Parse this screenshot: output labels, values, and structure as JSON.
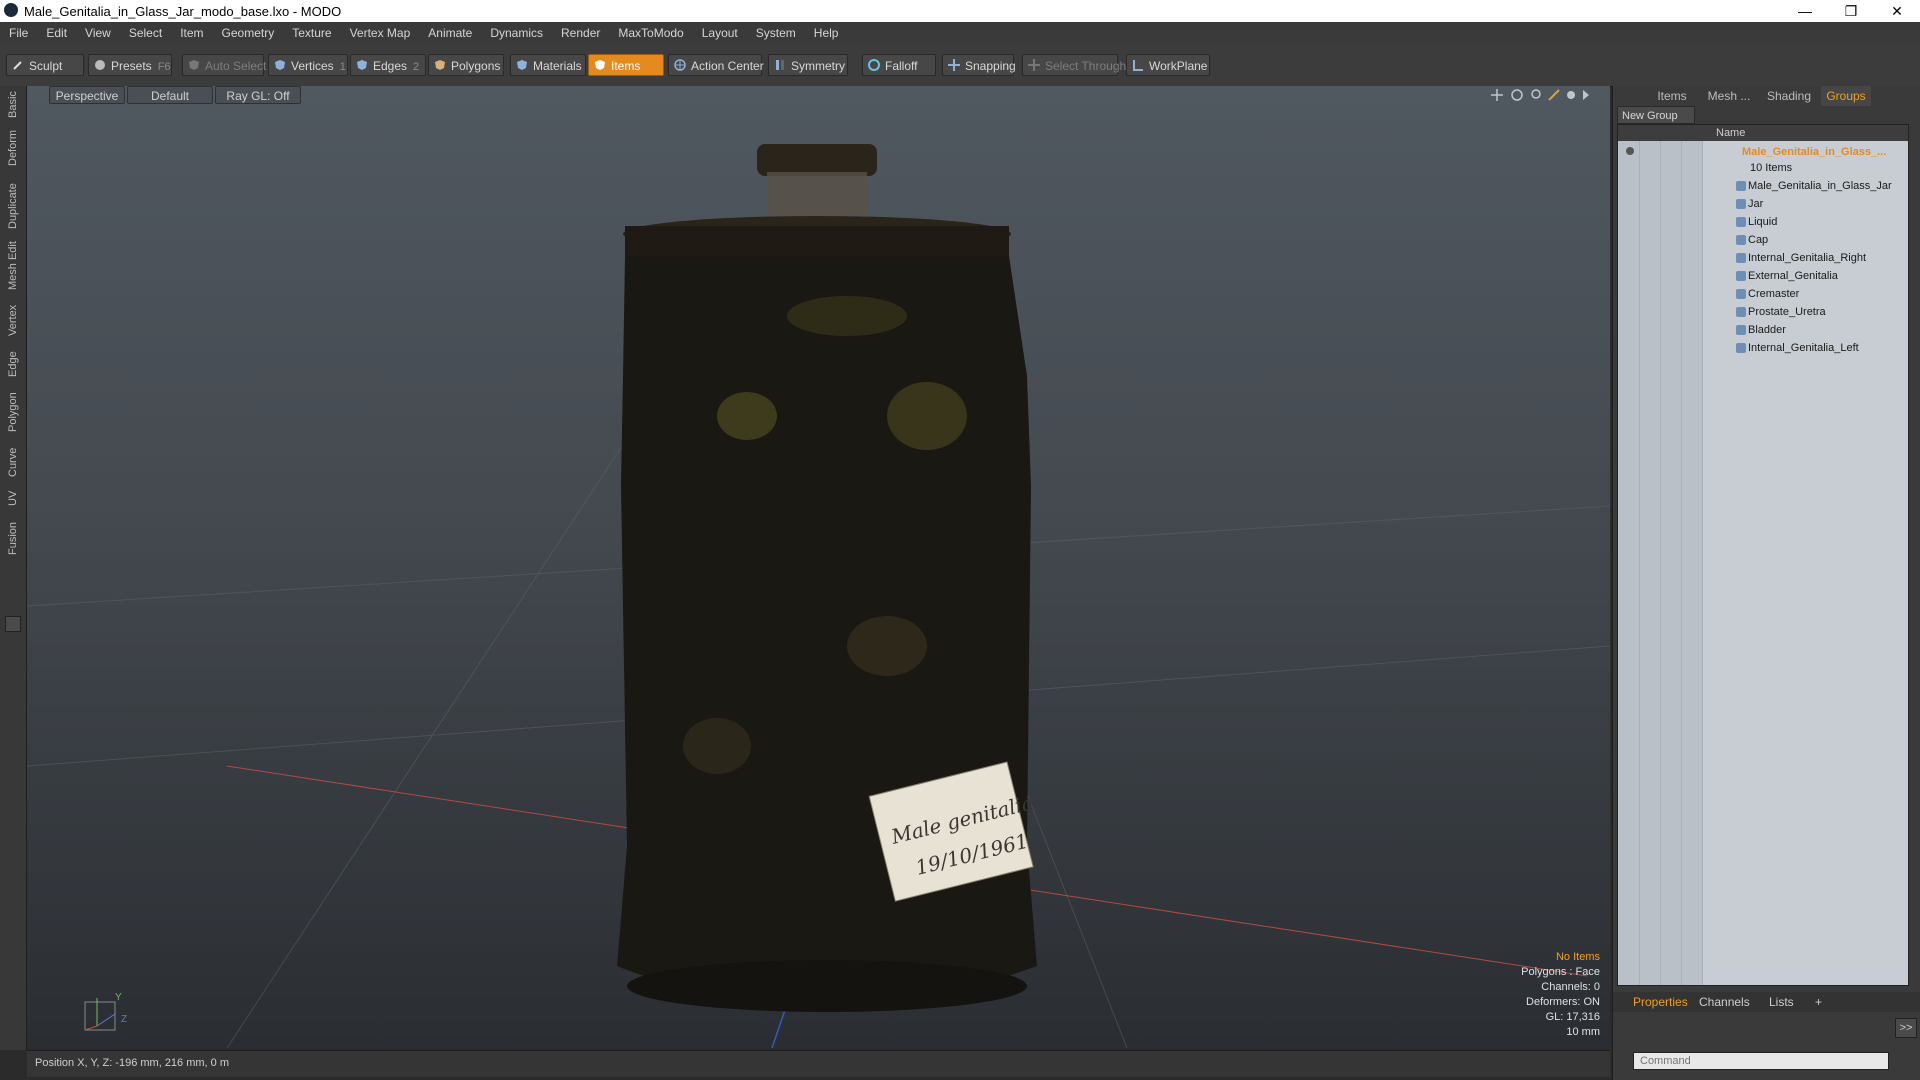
{
  "window": {
    "title": "Male_Genitalia_in_Glass_Jar_modo_base.lxo - MODO",
    "min": "—",
    "max": "❐",
    "close": "✕"
  },
  "menu": [
    "File",
    "Edit",
    "View",
    "Select",
    "Item",
    "Geometry",
    "Texture",
    "Vertex Map",
    "Animate",
    "Dynamics",
    "Render",
    "MaxToModo",
    "Layout",
    "System",
    "Help"
  ],
  "toolbar": {
    "sculpt": "Sculpt",
    "presets": "Presets",
    "presets_key": "F6",
    "auto_select": "Auto Select",
    "vertices": "Vertices",
    "vertices_key": "1",
    "edges": "Edges",
    "edges_key": "2",
    "polygons": "Polygons",
    "materials": "Materials",
    "items": "Items",
    "action_center": "Action Center",
    "symmetry": "Symmetry",
    "falloff": "Falloff",
    "snapping": "Snapping",
    "select_through": "Select Through",
    "workplane": "WorkPlane"
  },
  "left_tabs": [
    "Basic",
    "Deform",
    "Duplicate",
    "Mesh Edit",
    "Vertex",
    "Edge",
    "Polygon",
    "Curve",
    "UV",
    "Fusion"
  ],
  "viewport": {
    "view": "Perspective",
    "shading": "Default",
    "raygl": "Ray GL: Off",
    "label_line1": "Male genitalia",
    "label_line2": "19/10/1961",
    "info": {
      "selection": "No Items",
      "polygons": "Polygons : Face",
      "channels": "Channels: 0",
      "deformers": "Deformers: ON",
      "gl": "GL: 17,316",
      "scale": "10 mm"
    },
    "axis_y": "Y",
    "axis_z": "Z"
  },
  "status": {
    "position": "Position X, Y, Z:  -196 mm, 216 mm, 0 m"
  },
  "right_panel": {
    "tabs": [
      "Items",
      "Mesh ...",
      "Shading",
      "Groups"
    ],
    "active_tab": "Groups",
    "new_group": "New Group",
    "col_name": "Name",
    "group_name": "Male_Genitalia_in_Glass_...",
    "group_count": "10 Items",
    "items": [
      "Male_Genitalia_in_Glass_Jar",
      "Jar",
      "Liquid",
      "Cap",
      "Internal_Genitalia_Right",
      "External_Genitalia",
      "Cremaster",
      "Prostate_Uretra",
      "Bladder",
      "Internal_Genitalia_Left"
    ],
    "bottom_tabs": [
      "Properties",
      "Channels",
      "Lists",
      "+"
    ],
    "command_placeholder": "Command",
    "expand": ">>"
  }
}
